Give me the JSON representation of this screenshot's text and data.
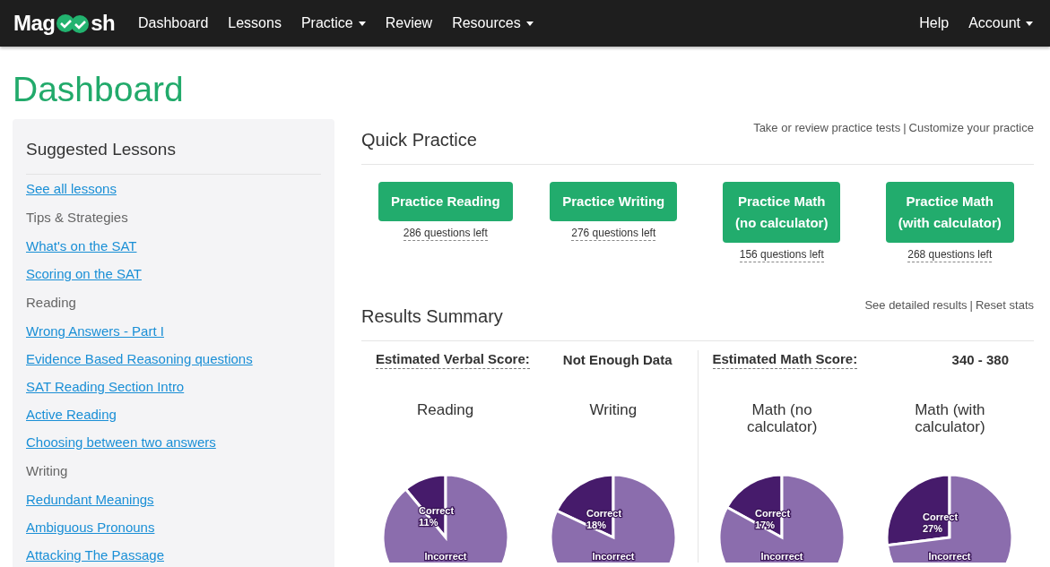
{
  "navbar": {
    "logo": {
      "before": "Mag",
      "after": "sh"
    },
    "items": [
      {
        "label": "Dashboard",
        "dropdown": false
      },
      {
        "label": "Lessons",
        "dropdown": false
      },
      {
        "label": "Practice",
        "dropdown": true
      },
      {
        "label": "Review",
        "dropdown": false
      },
      {
        "label": "Resources",
        "dropdown": true
      }
    ],
    "right_items": [
      {
        "label": "Help",
        "dropdown": false
      },
      {
        "label": "Account",
        "dropdown": true
      }
    ]
  },
  "page_title": "Dashboard",
  "sidebar": {
    "title": "Suggested Lessons",
    "items": [
      {
        "kind": "link",
        "label": "See all lessons"
      },
      {
        "kind": "heading",
        "label": "Tips & Strategies"
      },
      {
        "kind": "link",
        "label": "What's on the SAT"
      },
      {
        "kind": "link",
        "label": "Scoring on the SAT"
      },
      {
        "kind": "heading",
        "label": "Reading"
      },
      {
        "kind": "link",
        "label": "Wrong Answers - Part I"
      },
      {
        "kind": "link",
        "label": "Evidence Based Reasoning questions"
      },
      {
        "kind": "link",
        "label": "SAT Reading Section Intro"
      },
      {
        "kind": "link",
        "label": "Active Reading"
      },
      {
        "kind": "link",
        "label": "Choosing between two answers"
      },
      {
        "kind": "heading",
        "label": "Writing"
      },
      {
        "kind": "link",
        "label": "Redundant Meanings"
      },
      {
        "kind": "link",
        "label": "Ambiguous Pronouns"
      },
      {
        "kind": "link",
        "label": "Attacking The Passage"
      }
    ]
  },
  "quick_practice": {
    "title": "Quick Practice",
    "links": [
      "Take or review practice tests",
      "Customize your practice"
    ],
    "separator": "|",
    "buttons": [
      {
        "lines": [
          "Practice Reading"
        ],
        "remaining": "286 questions left"
      },
      {
        "lines": [
          "Practice Writing"
        ],
        "remaining": "276 questions left"
      },
      {
        "lines": [
          "Practice Math",
          "(no calculator)"
        ],
        "remaining": "156 questions left"
      },
      {
        "lines": [
          "Practice Math",
          "(with calculator)"
        ],
        "remaining": "268 questions left"
      }
    ]
  },
  "results_summary": {
    "title": "Results Summary",
    "links": [
      "See detailed results",
      "Reset stats"
    ],
    "separator": "|",
    "scores": [
      {
        "label": "Estimated Verbal Score:",
        "value": "Not Enough Data"
      },
      {
        "label": "Estimated Math Score:",
        "value": "340 - 380"
      }
    ],
    "charts": [
      {
        "title": "Reading",
        "chart_data": {
          "type": "pie",
          "categories": [
            "Correct",
            "Incorrect"
          ],
          "values": [
            11,
            89
          ]
        },
        "correct_value": "11%"
      },
      {
        "title": "Writing",
        "chart_data": {
          "type": "pie",
          "categories": [
            "Correct",
            "Incorrect"
          ],
          "values": [
            18,
            82
          ]
        },
        "correct_value": "18%"
      },
      {
        "title": "Math (no calculator)",
        "chart_data": {
          "type": "pie",
          "categories": [
            "Correct",
            "Incorrect"
          ],
          "values": [
            17,
            83
          ]
        },
        "correct_value": "17%"
      },
      {
        "title": "Math (with calculator)",
        "chart_data": {
          "type": "pie",
          "categories": [
            "Correct",
            "Incorrect"
          ],
          "values": [
            27,
            73
          ]
        },
        "correct_value": "27%"
      }
    ]
  }
}
